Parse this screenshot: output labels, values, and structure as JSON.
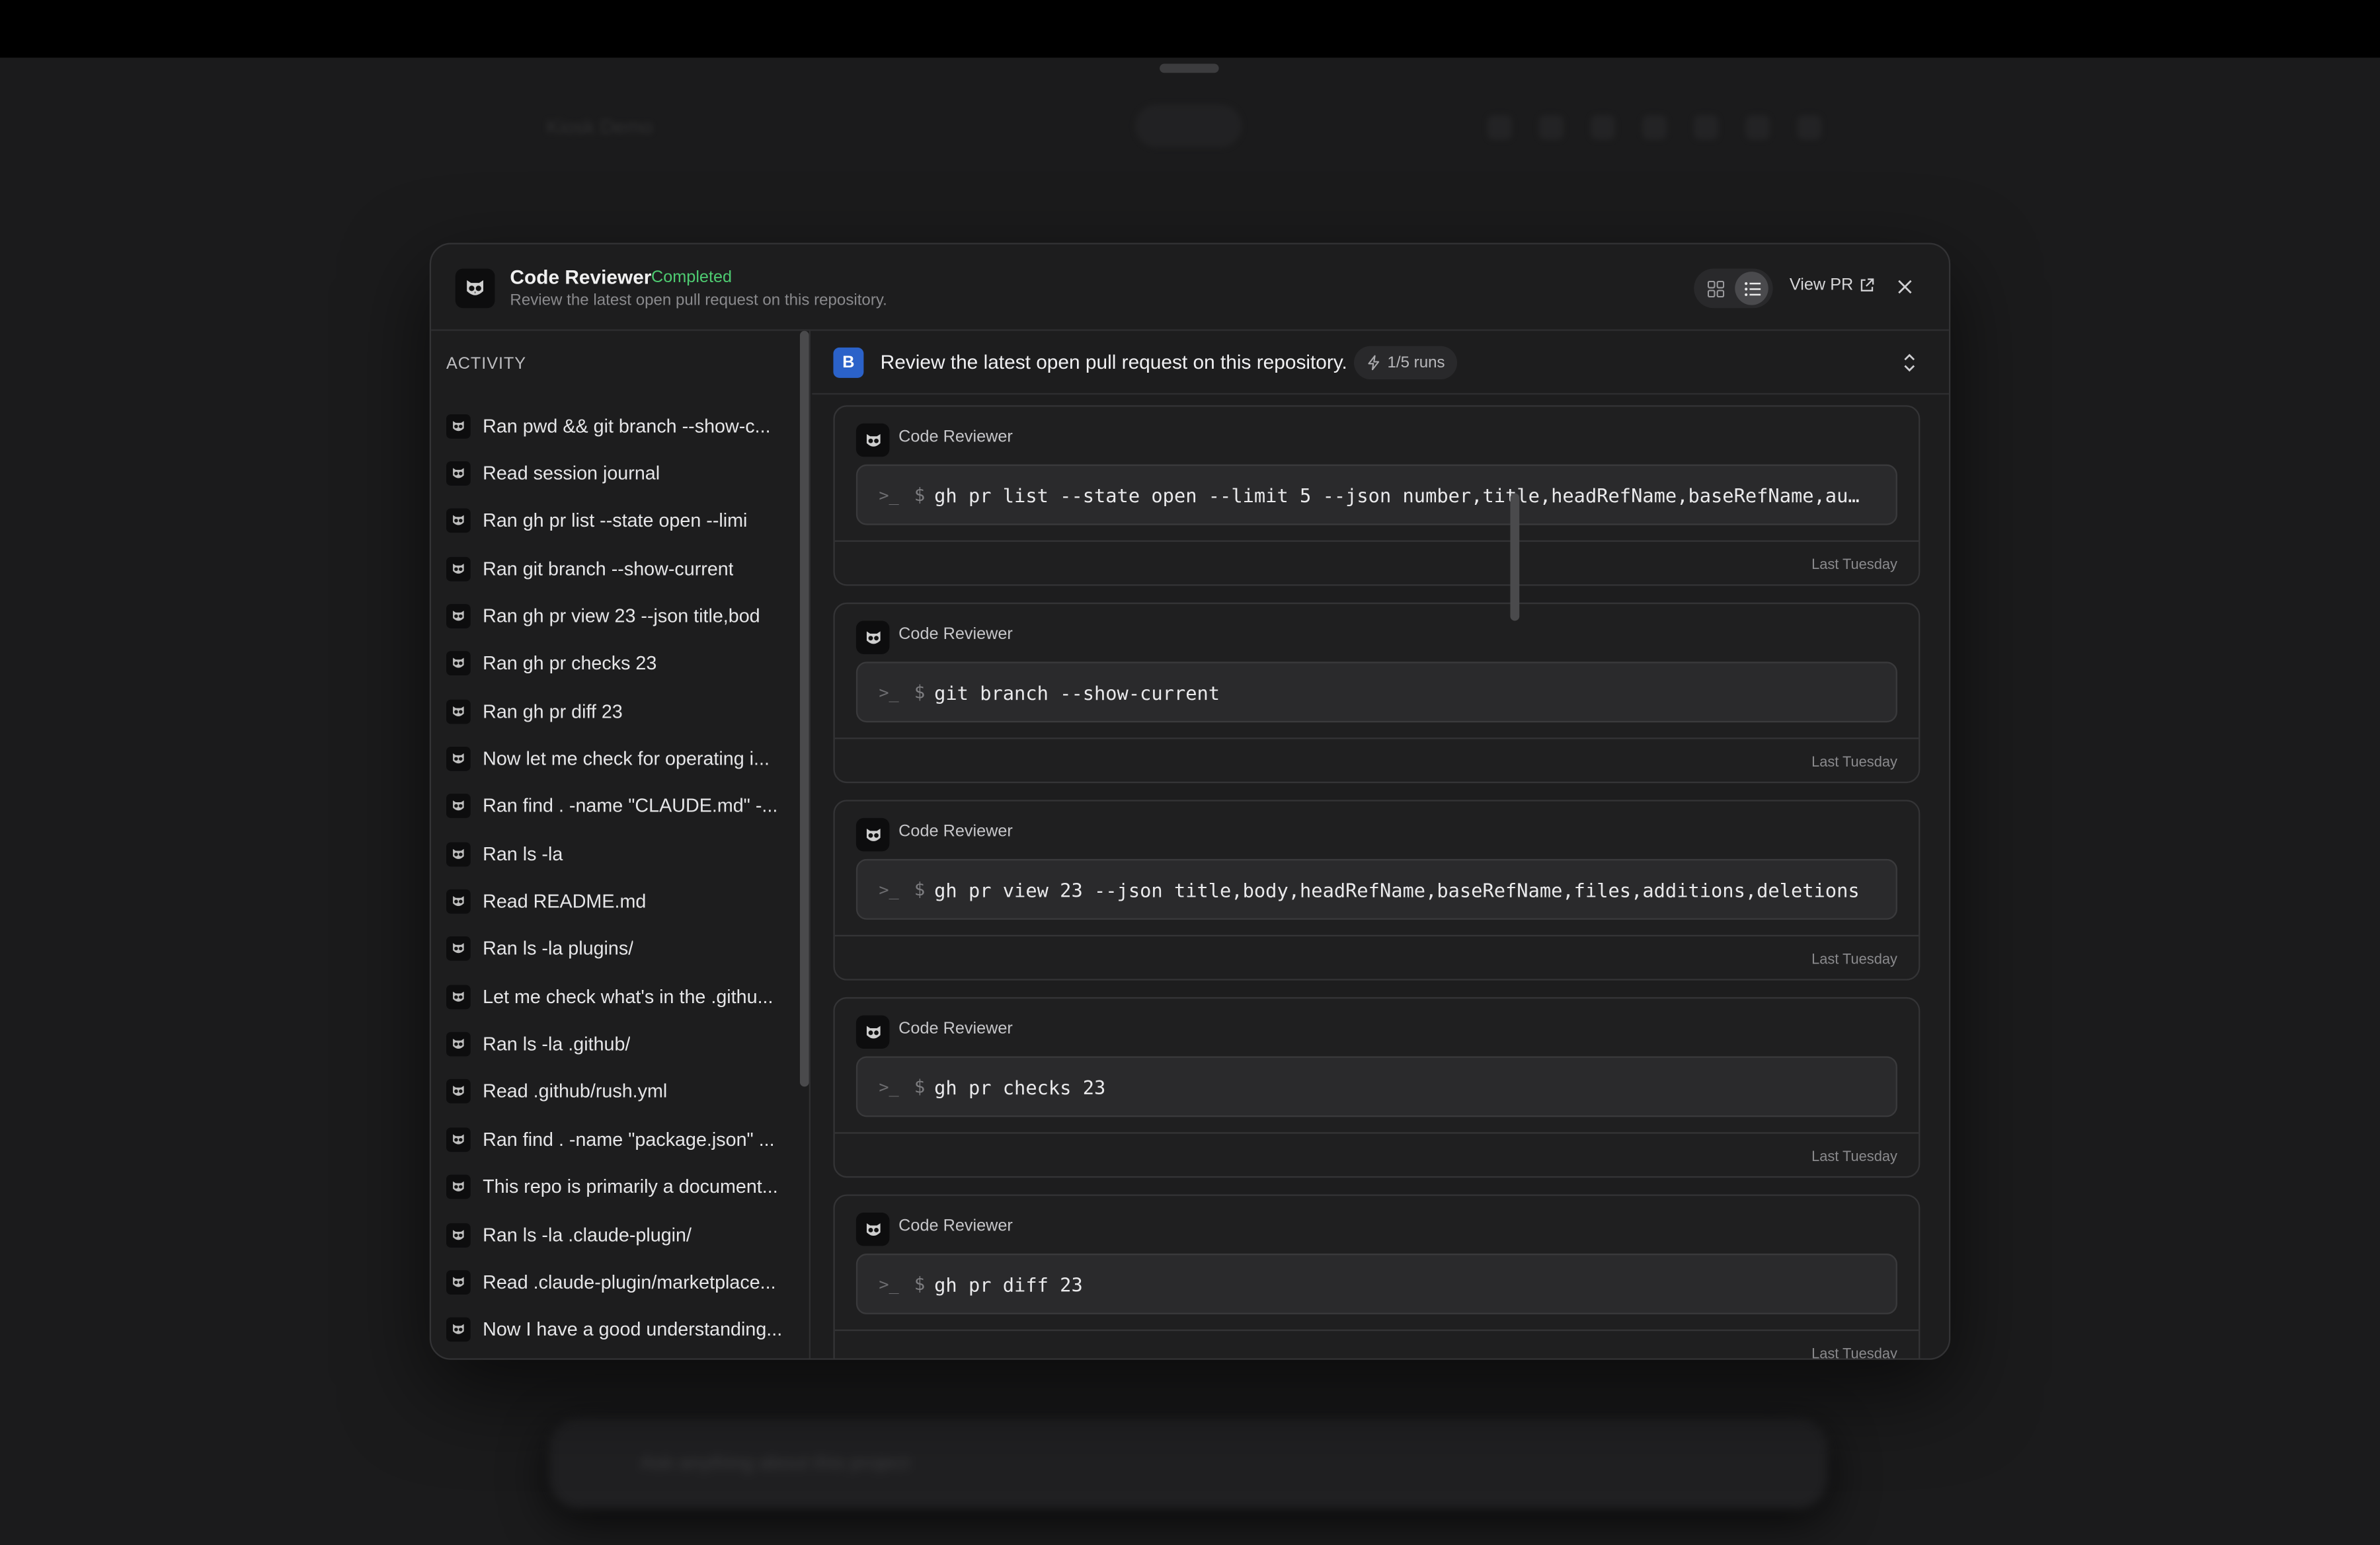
{
  "background": {
    "app_title": "Kiosk Demo",
    "composer_placeholder": "Ask anything about this project"
  },
  "modal": {
    "agent_name": "Code Reviewer",
    "status": "Completed",
    "subtitle": "Review the latest open pull request on this repository.",
    "view_pr_label": "View PR",
    "status_color": "#4ecb71"
  },
  "sidebar": {
    "heading": "ACTIVITY",
    "items": [
      {
        "label": "Ran pwd && git branch --show-c..."
      },
      {
        "label": "Read session journal"
      },
      {
        "label": "Ran gh pr list --state open --limi"
      },
      {
        "label": "Ran git branch --show-current"
      },
      {
        "label": "Ran gh pr view 23 --json title,bod"
      },
      {
        "label": "Ran gh pr checks 23"
      },
      {
        "label": "Ran gh pr diff 23"
      },
      {
        "label": "Now let me check for operating i..."
      },
      {
        "label": "Ran find . -name \"CLAUDE.md\" -..."
      },
      {
        "label": "Ran ls -la"
      },
      {
        "label": "Read README.md"
      },
      {
        "label": "Ran ls -la plugins/"
      },
      {
        "label": "Let me check what's in the .githu..."
      },
      {
        "label": "Ran ls -la .github/"
      },
      {
        "label": "Read .github/rush.yml"
      },
      {
        "label": "Ran find . -name \"package.json\" ..."
      },
      {
        "label": "This repo is primarily a document..."
      },
      {
        "label": "Ran ls -la .claude-plugin/"
      },
      {
        "label": "Read .claude-plugin/marketplace..."
      },
      {
        "label": "Now I have a good understanding..."
      }
    ]
  },
  "run": {
    "badge": "B",
    "prompt": "Review the latest open pull request on this repository.",
    "runs_label": "1/5 runs",
    "badge_color": "#2b62c9"
  },
  "cards": [
    {
      "author": "Code Reviewer",
      "command": "gh pr list --state open --limit 5 --json number,title,headRefName,baseRefName,aut…",
      "time": "Last Tuesday"
    },
    {
      "author": "Code Reviewer",
      "command": "git branch --show-current",
      "time": "Last Tuesday"
    },
    {
      "author": "Code Reviewer",
      "command": "gh pr view 23 --json title,body,headRefName,baseRefName,files,additions,deletions",
      "time": "Last Tuesday"
    },
    {
      "author": "Code Reviewer",
      "command": "gh pr checks 23",
      "time": "Last Tuesday"
    },
    {
      "author": "Code Reviewer",
      "command": "gh pr diff 23",
      "time": "Last Tuesday"
    }
  ],
  "icons": {
    "agent_avatar": "owl-icon",
    "terminal": "terminal-prompt-icon",
    "dollar": "$",
    "view_grid": "grid-icon",
    "view_list": "list-icon",
    "external_link": "external-link-icon",
    "close": "close-icon",
    "expand": "chevron-up-down-icon",
    "runs": "lightning-icon"
  }
}
